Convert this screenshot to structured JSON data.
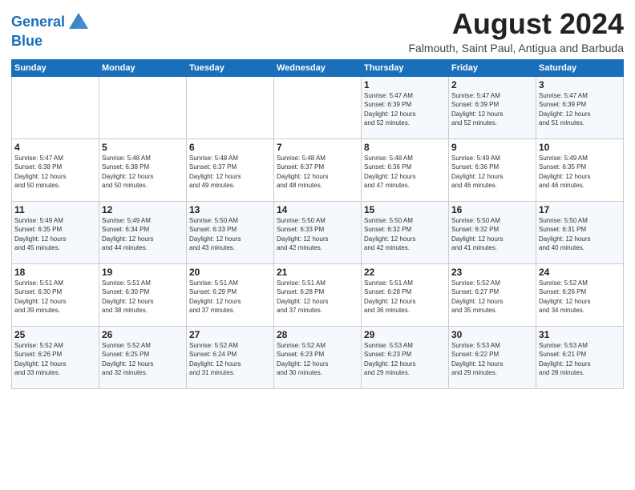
{
  "logo": {
    "line1": "General",
    "line2": "Blue"
  },
  "title": "August 2024",
  "location": "Falmouth, Saint Paul, Antigua and Barbuda",
  "days_of_week": [
    "Sunday",
    "Monday",
    "Tuesday",
    "Wednesday",
    "Thursday",
    "Friday",
    "Saturday"
  ],
  "weeks": [
    [
      {
        "day": "",
        "info": ""
      },
      {
        "day": "",
        "info": ""
      },
      {
        "day": "",
        "info": ""
      },
      {
        "day": "",
        "info": ""
      },
      {
        "day": "1",
        "info": "Sunrise: 5:47 AM\nSunset: 6:39 PM\nDaylight: 12 hours\nand 52 minutes."
      },
      {
        "day": "2",
        "info": "Sunrise: 5:47 AM\nSunset: 6:39 PM\nDaylight: 12 hours\nand 52 minutes."
      },
      {
        "day": "3",
        "info": "Sunrise: 5:47 AM\nSunset: 6:39 PM\nDaylight: 12 hours\nand 51 minutes."
      }
    ],
    [
      {
        "day": "4",
        "info": "Sunrise: 5:47 AM\nSunset: 6:38 PM\nDaylight: 12 hours\nand 50 minutes."
      },
      {
        "day": "5",
        "info": "Sunrise: 5:48 AM\nSunset: 6:38 PM\nDaylight: 12 hours\nand 50 minutes."
      },
      {
        "day": "6",
        "info": "Sunrise: 5:48 AM\nSunset: 6:37 PM\nDaylight: 12 hours\nand 49 minutes."
      },
      {
        "day": "7",
        "info": "Sunrise: 5:48 AM\nSunset: 6:37 PM\nDaylight: 12 hours\nand 48 minutes."
      },
      {
        "day": "8",
        "info": "Sunrise: 5:48 AM\nSunset: 6:36 PM\nDaylight: 12 hours\nand 47 minutes."
      },
      {
        "day": "9",
        "info": "Sunrise: 5:49 AM\nSunset: 6:36 PM\nDaylight: 12 hours\nand 46 minutes."
      },
      {
        "day": "10",
        "info": "Sunrise: 5:49 AM\nSunset: 6:35 PM\nDaylight: 12 hours\nand 46 minutes."
      }
    ],
    [
      {
        "day": "11",
        "info": "Sunrise: 5:49 AM\nSunset: 6:35 PM\nDaylight: 12 hours\nand 45 minutes."
      },
      {
        "day": "12",
        "info": "Sunrise: 5:49 AM\nSunset: 6:34 PM\nDaylight: 12 hours\nand 44 minutes."
      },
      {
        "day": "13",
        "info": "Sunrise: 5:50 AM\nSunset: 6:33 PM\nDaylight: 12 hours\nand 43 minutes."
      },
      {
        "day": "14",
        "info": "Sunrise: 5:50 AM\nSunset: 6:33 PM\nDaylight: 12 hours\nand 42 minutes."
      },
      {
        "day": "15",
        "info": "Sunrise: 5:50 AM\nSunset: 6:32 PM\nDaylight: 12 hours\nand 42 minutes."
      },
      {
        "day": "16",
        "info": "Sunrise: 5:50 AM\nSunset: 6:32 PM\nDaylight: 12 hours\nand 41 minutes."
      },
      {
        "day": "17",
        "info": "Sunrise: 5:50 AM\nSunset: 6:31 PM\nDaylight: 12 hours\nand 40 minutes."
      }
    ],
    [
      {
        "day": "18",
        "info": "Sunrise: 5:51 AM\nSunset: 6:30 PM\nDaylight: 12 hours\nand 39 minutes."
      },
      {
        "day": "19",
        "info": "Sunrise: 5:51 AM\nSunset: 6:30 PM\nDaylight: 12 hours\nand 38 minutes."
      },
      {
        "day": "20",
        "info": "Sunrise: 5:51 AM\nSunset: 6:29 PM\nDaylight: 12 hours\nand 37 minutes."
      },
      {
        "day": "21",
        "info": "Sunrise: 5:51 AM\nSunset: 6:28 PM\nDaylight: 12 hours\nand 37 minutes."
      },
      {
        "day": "22",
        "info": "Sunrise: 5:51 AM\nSunset: 6:28 PM\nDaylight: 12 hours\nand 36 minutes."
      },
      {
        "day": "23",
        "info": "Sunrise: 5:52 AM\nSunset: 6:27 PM\nDaylight: 12 hours\nand 35 minutes."
      },
      {
        "day": "24",
        "info": "Sunrise: 5:52 AM\nSunset: 6:26 PM\nDaylight: 12 hours\nand 34 minutes."
      }
    ],
    [
      {
        "day": "25",
        "info": "Sunrise: 5:52 AM\nSunset: 6:26 PM\nDaylight: 12 hours\nand 33 minutes."
      },
      {
        "day": "26",
        "info": "Sunrise: 5:52 AM\nSunset: 6:25 PM\nDaylight: 12 hours\nand 32 minutes."
      },
      {
        "day": "27",
        "info": "Sunrise: 5:52 AM\nSunset: 6:24 PM\nDaylight: 12 hours\nand 31 minutes."
      },
      {
        "day": "28",
        "info": "Sunrise: 5:52 AM\nSunset: 6:23 PM\nDaylight: 12 hours\nand 30 minutes."
      },
      {
        "day": "29",
        "info": "Sunrise: 5:53 AM\nSunset: 6:23 PM\nDaylight: 12 hours\nand 29 minutes."
      },
      {
        "day": "30",
        "info": "Sunrise: 5:53 AM\nSunset: 6:22 PM\nDaylight: 12 hours\nand 29 minutes."
      },
      {
        "day": "31",
        "info": "Sunrise: 5:53 AM\nSunset: 6:21 PM\nDaylight: 12 hours\nand 28 minutes."
      }
    ]
  ]
}
